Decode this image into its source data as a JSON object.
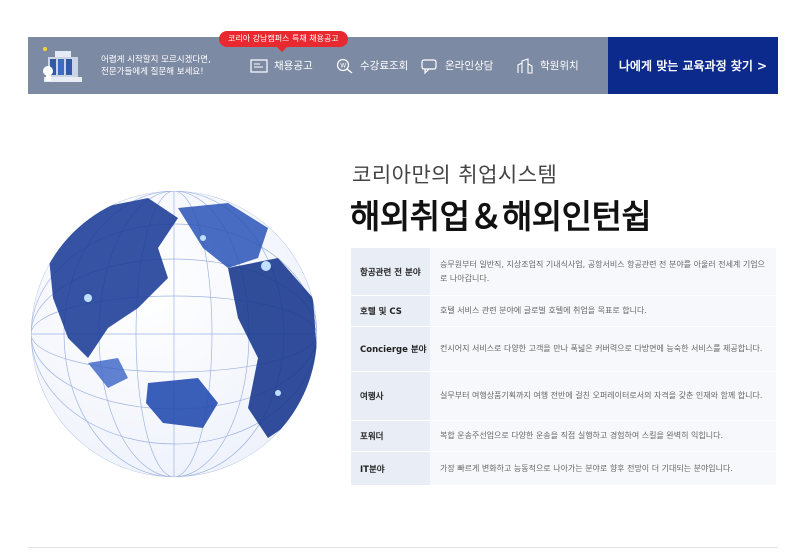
{
  "topbar": {
    "consult_line1": "어렵게 시작할지 모르시겠다면,",
    "consult_line2": "전문가들에게 질문해 보세요!",
    "badge": "코리아 강남캠퍼스 특채 채용공고",
    "nav": [
      {
        "label": "채용공고",
        "icon": "job-board-icon"
      },
      {
        "label": "수강료조회",
        "icon": "fee-search-icon"
      },
      {
        "label": "온라인상담",
        "icon": "chat-icon"
      },
      {
        "label": "학원위치",
        "icon": "location-icon"
      }
    ],
    "cta": "나에게 맞는 교육과정 찾기 >"
  },
  "hero": {
    "subtitle": "코리아만의 취업시스템",
    "title": "해외취업＆해외인턴쉽"
  },
  "fields": [
    {
      "label": "항공관련 전 분야",
      "desc": "승무원부터 일반직, 지상조업직 기내식사업, 공항서비스 항공관련 전 분야를 아울러 전세계 기업으로 나아갑니다."
    },
    {
      "label": "호텔 및 CS",
      "desc": "호텔 서비스 관련 분야에 글로벌 호텔에 취업을 목표로 합니다."
    },
    {
      "label": "Concierge 분야",
      "desc": "컨시어지 서비스로 다양한 고객을 만나 폭넓은 커버력으로 다방면에 능숙한 서비스를 제공합니다."
    },
    {
      "label": "여행사",
      "desc": "실무부터 여행상품기획까지 여행 전반에 걸친 오퍼레이터로서의 자격을 갖춘 인재와 함께 합니다."
    },
    {
      "label": "포워더",
      "desc": "복합 운송주선업으로 다양한 운송을 직접 실행하고 경험하여 스킬을 완벽히 익힙니다."
    },
    {
      "label": "IT분야",
      "desc": "가장 빠르게 변화하고 능동적으로 나아가는 분야로 향후 전망이 더 기대되는 분야입니다."
    }
  ],
  "colors": {
    "topbar": "#7d8aa3",
    "cta": "#0b2a8c",
    "badge": "#e8292f",
    "label_cell": "#e9edf5",
    "desc_cell": "#f7f8fb"
  }
}
